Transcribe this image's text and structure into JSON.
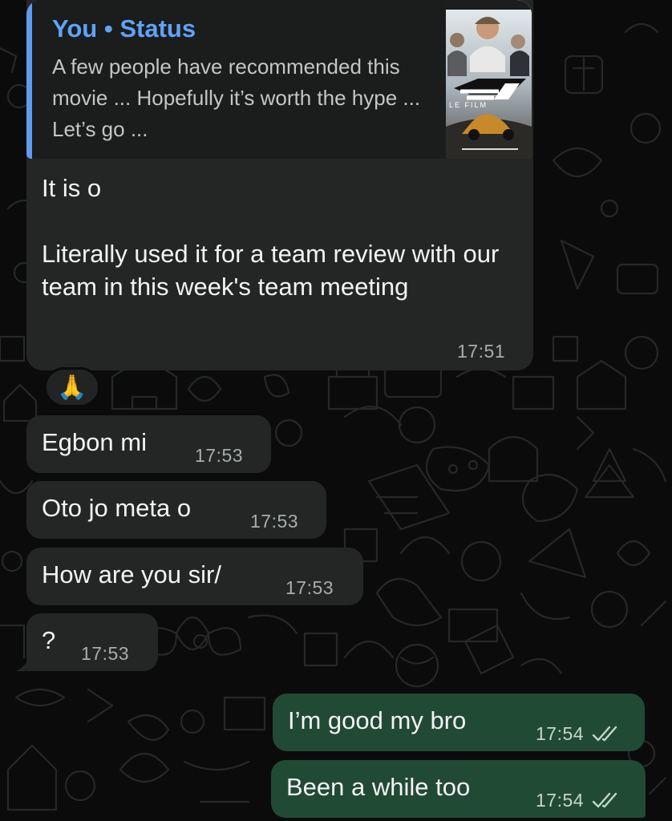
{
  "messages": {
    "reply": {
      "quote_author": "You • Status",
      "quote_text": "A few people have recommended this movie ... Hopefully it’s worth the hype ... Let’s go ...",
      "poster_caption": "LE FILM",
      "body": "It is o\n\nLiterally used it for a team review with our team in this week's team meeting",
      "time": "17:51",
      "reaction": "🙏"
    },
    "m1": {
      "text": "Egbon mi",
      "time": "17:53"
    },
    "m2": {
      "text": "Oto jo meta o",
      "time": "17:53"
    },
    "m3": {
      "text": "How are you sir/",
      "time": "17:53"
    },
    "m4": {
      "text": "?",
      "time": "17:53"
    },
    "o1": {
      "text": "I’m good my bro",
      "time": "17:54",
      "status": "read-double-tick-icon"
    },
    "o2": {
      "text": "Been a while too",
      "time": "17:54",
      "status": "read-double-tick-icon"
    }
  },
  "colors": {
    "incoming_bubble": "#242626",
    "outgoing_bubble": "#214a34",
    "quote_accent": "#5fa3f5",
    "background": "#0b0b0b"
  }
}
